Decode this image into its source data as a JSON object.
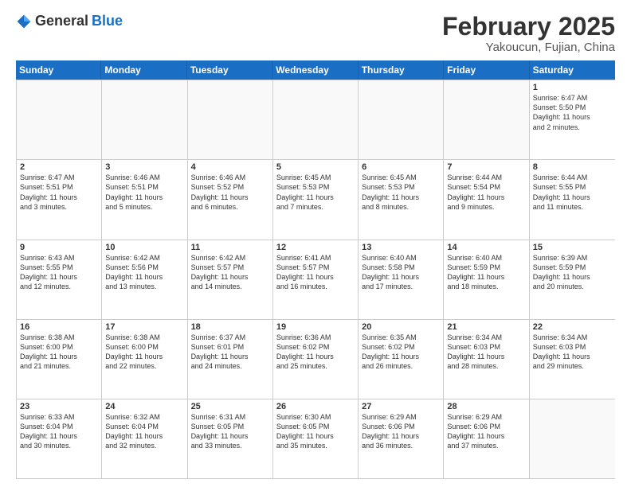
{
  "header": {
    "logo_general": "General",
    "logo_blue": "Blue",
    "month_title": "February 2025",
    "location": "Yakoucun, Fujian, China"
  },
  "weekdays": [
    "Sunday",
    "Monday",
    "Tuesday",
    "Wednesday",
    "Thursday",
    "Friday",
    "Saturday"
  ],
  "weeks": [
    [
      {
        "day": "",
        "text": ""
      },
      {
        "day": "",
        "text": ""
      },
      {
        "day": "",
        "text": ""
      },
      {
        "day": "",
        "text": ""
      },
      {
        "day": "",
        "text": ""
      },
      {
        "day": "",
        "text": ""
      },
      {
        "day": "1",
        "text": "Sunrise: 6:47 AM\nSunset: 5:50 PM\nDaylight: 11 hours\nand 2 minutes."
      }
    ],
    [
      {
        "day": "2",
        "text": "Sunrise: 6:47 AM\nSunset: 5:51 PM\nDaylight: 11 hours\nand 3 minutes."
      },
      {
        "day": "3",
        "text": "Sunrise: 6:46 AM\nSunset: 5:51 PM\nDaylight: 11 hours\nand 5 minutes."
      },
      {
        "day": "4",
        "text": "Sunrise: 6:46 AM\nSunset: 5:52 PM\nDaylight: 11 hours\nand 6 minutes."
      },
      {
        "day": "5",
        "text": "Sunrise: 6:45 AM\nSunset: 5:53 PM\nDaylight: 11 hours\nand 7 minutes."
      },
      {
        "day": "6",
        "text": "Sunrise: 6:45 AM\nSunset: 5:53 PM\nDaylight: 11 hours\nand 8 minutes."
      },
      {
        "day": "7",
        "text": "Sunrise: 6:44 AM\nSunset: 5:54 PM\nDaylight: 11 hours\nand 9 minutes."
      },
      {
        "day": "8",
        "text": "Sunrise: 6:44 AM\nSunset: 5:55 PM\nDaylight: 11 hours\nand 11 minutes."
      }
    ],
    [
      {
        "day": "9",
        "text": "Sunrise: 6:43 AM\nSunset: 5:55 PM\nDaylight: 11 hours\nand 12 minutes."
      },
      {
        "day": "10",
        "text": "Sunrise: 6:42 AM\nSunset: 5:56 PM\nDaylight: 11 hours\nand 13 minutes."
      },
      {
        "day": "11",
        "text": "Sunrise: 6:42 AM\nSunset: 5:57 PM\nDaylight: 11 hours\nand 14 minutes."
      },
      {
        "day": "12",
        "text": "Sunrise: 6:41 AM\nSunset: 5:57 PM\nDaylight: 11 hours\nand 16 minutes."
      },
      {
        "day": "13",
        "text": "Sunrise: 6:40 AM\nSunset: 5:58 PM\nDaylight: 11 hours\nand 17 minutes."
      },
      {
        "day": "14",
        "text": "Sunrise: 6:40 AM\nSunset: 5:59 PM\nDaylight: 11 hours\nand 18 minutes."
      },
      {
        "day": "15",
        "text": "Sunrise: 6:39 AM\nSunset: 5:59 PM\nDaylight: 11 hours\nand 20 minutes."
      }
    ],
    [
      {
        "day": "16",
        "text": "Sunrise: 6:38 AM\nSunset: 6:00 PM\nDaylight: 11 hours\nand 21 minutes."
      },
      {
        "day": "17",
        "text": "Sunrise: 6:38 AM\nSunset: 6:00 PM\nDaylight: 11 hours\nand 22 minutes."
      },
      {
        "day": "18",
        "text": "Sunrise: 6:37 AM\nSunset: 6:01 PM\nDaylight: 11 hours\nand 24 minutes."
      },
      {
        "day": "19",
        "text": "Sunrise: 6:36 AM\nSunset: 6:02 PM\nDaylight: 11 hours\nand 25 minutes."
      },
      {
        "day": "20",
        "text": "Sunrise: 6:35 AM\nSunset: 6:02 PM\nDaylight: 11 hours\nand 26 minutes."
      },
      {
        "day": "21",
        "text": "Sunrise: 6:34 AM\nSunset: 6:03 PM\nDaylight: 11 hours\nand 28 minutes."
      },
      {
        "day": "22",
        "text": "Sunrise: 6:34 AM\nSunset: 6:03 PM\nDaylight: 11 hours\nand 29 minutes."
      }
    ],
    [
      {
        "day": "23",
        "text": "Sunrise: 6:33 AM\nSunset: 6:04 PM\nDaylight: 11 hours\nand 30 minutes."
      },
      {
        "day": "24",
        "text": "Sunrise: 6:32 AM\nSunset: 6:04 PM\nDaylight: 11 hours\nand 32 minutes."
      },
      {
        "day": "25",
        "text": "Sunrise: 6:31 AM\nSunset: 6:05 PM\nDaylight: 11 hours\nand 33 minutes."
      },
      {
        "day": "26",
        "text": "Sunrise: 6:30 AM\nSunset: 6:05 PM\nDaylight: 11 hours\nand 35 minutes."
      },
      {
        "day": "27",
        "text": "Sunrise: 6:29 AM\nSunset: 6:06 PM\nDaylight: 11 hours\nand 36 minutes."
      },
      {
        "day": "28",
        "text": "Sunrise: 6:29 AM\nSunset: 6:06 PM\nDaylight: 11 hours\nand 37 minutes."
      },
      {
        "day": "",
        "text": ""
      }
    ]
  ]
}
